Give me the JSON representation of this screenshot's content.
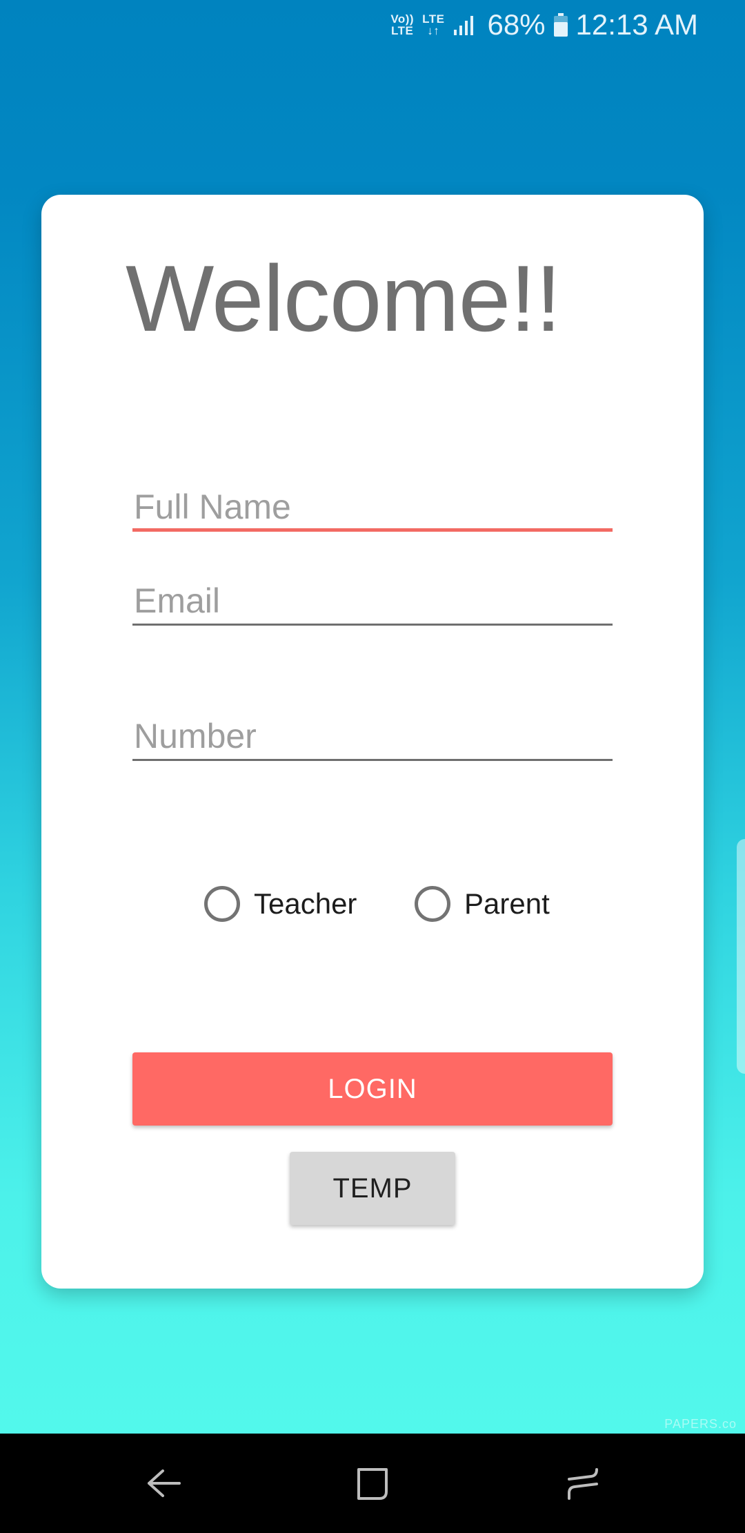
{
  "status_bar": {
    "volte_top": "Vo))",
    "volte_bottom": "LTE",
    "lte_top": "LTE",
    "lte_arrows": "↓↑",
    "battery_percent": "68%",
    "time": "12:13 AM",
    "text_color": "#e4f3fb"
  },
  "card": {
    "title": "Welcome!!",
    "fields": [
      {
        "placeholder": "Full Name",
        "value": "",
        "focused": true
      },
      {
        "placeholder": "Email",
        "value": ""
      },
      {
        "placeholder": "Number",
        "value": ""
      }
    ],
    "roles": [
      {
        "label": "Teacher",
        "selected": false
      },
      {
        "label": "Parent",
        "selected": false
      }
    ],
    "login_label": "LOGIN",
    "temp_label": "TEMP"
  },
  "watermark": "PAPERS.co",
  "nav_bar": {
    "icons": [
      "back-icon",
      "home-icon",
      "recents-icon"
    ]
  },
  "colors": {
    "background_top": "#0083bf",
    "background_bottom": "#55fbec",
    "accent": "#ff6964",
    "focus_underline": "#f26a63",
    "temp_button": "#d7d7d7",
    "title_text": "#707070"
  }
}
